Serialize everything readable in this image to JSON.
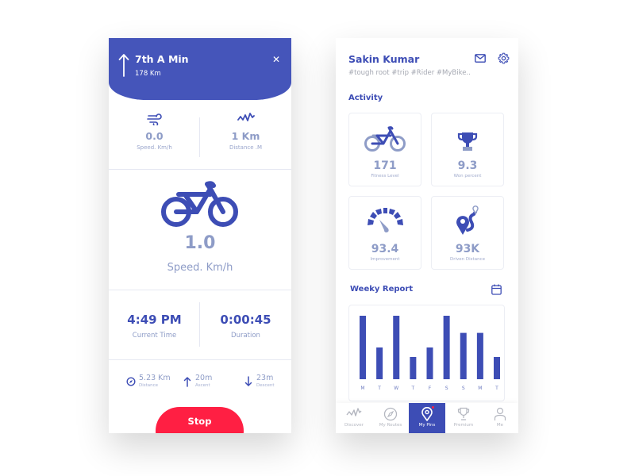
{
  "left_screen": {
    "navigation": {
      "direction_icon": "arrow-up-icon",
      "street": "7th A Min",
      "distance": "178 Km",
      "close_icon": "close-icon"
    },
    "quick_stats": [
      {
        "icon": "wind-icon",
        "value": "0.0",
        "label": "Speed. Km/h"
      },
      {
        "icon": "activity-icon",
        "value": "1 Km",
        "label": "Distance .M"
      }
    ],
    "main_metric": {
      "icon": "bicycle-icon",
      "value": "1.0",
      "label": "Speed. Km/h"
    },
    "time_stats": [
      {
        "value": "4:49 PM",
        "label": "Current Time"
      },
      {
        "value": "0:00:45",
        "label": "Duration"
      }
    ],
    "trip_stats": [
      {
        "icon": "compass-icon",
        "value": "5.23 Km",
        "label": "Distance"
      },
      {
        "icon": "arrow-up-icon",
        "value": "20m",
        "label": "Ascent"
      },
      {
        "icon": "arrow-down-icon",
        "value": "23m",
        "label": "Descent"
      }
    ],
    "stop_label": "Stop"
  },
  "right_screen": {
    "profile": {
      "name": "Sakin Kumar",
      "tags": "#tough root #trip #Rider #MyBike..",
      "mail_icon": "mail-icon",
      "settings_icon": "gear-icon"
    },
    "activity_title": "Activity",
    "activity_cards": [
      {
        "icon": "bicycle-icon",
        "value": "171",
        "label": "Fitness Level"
      },
      {
        "icon": "trophy-icon",
        "value": "9.3",
        "label": "Won percent"
      },
      {
        "icon": "speedometer-icon",
        "value": "93.4",
        "label": "Improvement"
      },
      {
        "icon": "route-pin-icon",
        "value": "93K",
        "label": "Driven Distance"
      }
    ],
    "weekly_title": "Weeky Report",
    "calendar_icon": "calendar-icon",
    "tabs": [
      {
        "icon": "activity-icon",
        "label": "Discover",
        "active": false
      },
      {
        "icon": "compass-icon",
        "label": "My Routes",
        "active": false
      },
      {
        "icon": "pin-icon",
        "label": "My Pins",
        "active": true,
        "notification": true
      },
      {
        "icon": "trophy-icon",
        "label": "Premium",
        "active": false
      },
      {
        "icon": "user-icon",
        "label": "Me",
        "active": false
      }
    ]
  },
  "colors": {
    "primary": "#4555ba",
    "bar": "#3d4db5",
    "muted": "#8e9cc7",
    "stop": "#ff1f43"
  },
  "chart_data": {
    "type": "bar",
    "title": "Weeky Report",
    "categories": [
      "M",
      "T",
      "W",
      "T",
      "F",
      "S",
      "S",
      "M",
      "T"
    ],
    "values": [
      100,
      50,
      100,
      35,
      50,
      100,
      73,
      73,
      35
    ],
    "xlabel": "",
    "ylabel": "",
    "ylim": [
      0,
      100
    ],
    "grid": false,
    "legend": "none"
  }
}
